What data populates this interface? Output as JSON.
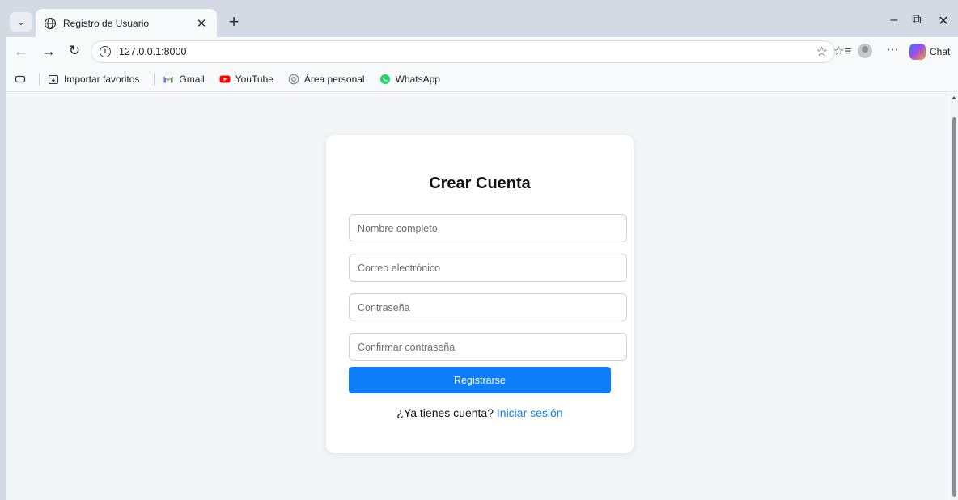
{
  "browser": {
    "tab": {
      "title": "Registro de Usuario"
    },
    "url": "127.0.0.1:8000",
    "chat_label": "Chat",
    "bookmarks": [
      {
        "label": "Importar favoritos",
        "icon": "import-icon"
      },
      {
        "label": "Gmail",
        "icon": "gmail-icon"
      },
      {
        "label": "YouTube",
        "icon": "youtube-icon"
      },
      {
        "label": "Área personal",
        "icon": "gear-icon"
      },
      {
        "label": "WhatsApp",
        "icon": "whatsapp-icon"
      }
    ]
  },
  "form": {
    "title": "Crear Cuenta",
    "fields": {
      "name": {
        "placeholder": "Nombre completo",
        "value": ""
      },
      "email": {
        "placeholder": "Correo electrónico",
        "value": ""
      },
      "password": {
        "placeholder": "Contraseña",
        "value": ""
      },
      "confirm": {
        "placeholder": "Confirmar contraseña",
        "value": ""
      }
    },
    "submit_label": "Registrarse",
    "footer_text": "¿Ya tienes cuenta?",
    "login_link": "Iniciar sesión"
  },
  "colors": {
    "accent": "#0d7ef8",
    "page_bg": "#f3f5f9",
    "card_bg": "#ffffff"
  }
}
